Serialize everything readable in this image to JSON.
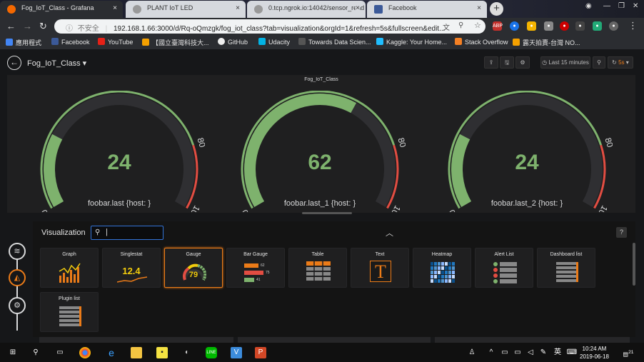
{
  "browser": {
    "tabs": [
      {
        "title": "Fog_IoT_Class - Grafana",
        "active": true
      },
      {
        "title": "PLANT IoT LED",
        "active": false
      },
      {
        "title": "0.tcp.ngrok.io:14042/sensor_read",
        "active": false
      },
      {
        "title": "Facebook",
        "active": false
      }
    ],
    "insecure_label": "不安全",
    "url": "192.168.1.66:3000/d/Rq-oQmzgk/fog_iot_class?tab=visualization&orgId=1&refresh=5s&fullscreen&edit...",
    "bookmarks": [
      "應用程式",
      "Facebook",
      "YouTube",
      "【國立臺灣科技大...",
      "GitHub",
      "Udacity",
      "Towards Data Scien...",
      "Kaggle: Your Home...",
      "Stack Overflow",
      "露天拍賣-台灣 NO..."
    ]
  },
  "dashboard": {
    "title": "Fog_IoT_Class",
    "time_range": "Last 15 minutes",
    "refresh": "5s"
  },
  "panel": {
    "title": "Fog_IoT_Class",
    "gauges": [
      {
        "value": 24,
        "label": "foobar.last {host: }",
        "min": 0,
        "max": 100,
        "threshold": 80
      },
      {
        "value": 62,
        "label": "foobar.last_1 {host: }",
        "min": 0,
        "max": 100,
        "threshold": 80
      },
      {
        "value": 24,
        "label": "foobar.last_2 {host: }",
        "min": 0,
        "max": 100,
        "threshold": 80
      }
    ],
    "tick_labels": [
      "0",
      "80",
      "100"
    ]
  },
  "visualization": {
    "label": "Visualization",
    "search_value": "|",
    "help": "?",
    "cards": [
      {
        "name": "Graph",
        "selected": false
      },
      {
        "name": "Singlestat",
        "selected": false,
        "preview": "12.4"
      },
      {
        "name": "Gauge",
        "selected": true,
        "preview": "79"
      },
      {
        "name": "Bar Gauge",
        "selected": false,
        "preview_values": [
          "62",
          "75",
          "41"
        ]
      },
      {
        "name": "Table",
        "selected": false
      },
      {
        "name": "Text",
        "selected": false,
        "preview": "T"
      },
      {
        "name": "Heatmap",
        "selected": false
      },
      {
        "name": "Alert List",
        "selected": false
      },
      {
        "name": "Dashboard list",
        "selected": false
      },
      {
        "name": "Plugin list",
        "selected": false
      }
    ]
  },
  "taskbar": {
    "ime": "英",
    "time": "10:24 AM",
    "date": "2019-06-18",
    "notifications": "21"
  },
  "colors": {
    "gauge_green": "#7eb26d",
    "gauge_red": "#e24d42",
    "gauge_track": "#2f2f32",
    "selected_border": "#eb7b18",
    "search_border": "#3274d9"
  }
}
